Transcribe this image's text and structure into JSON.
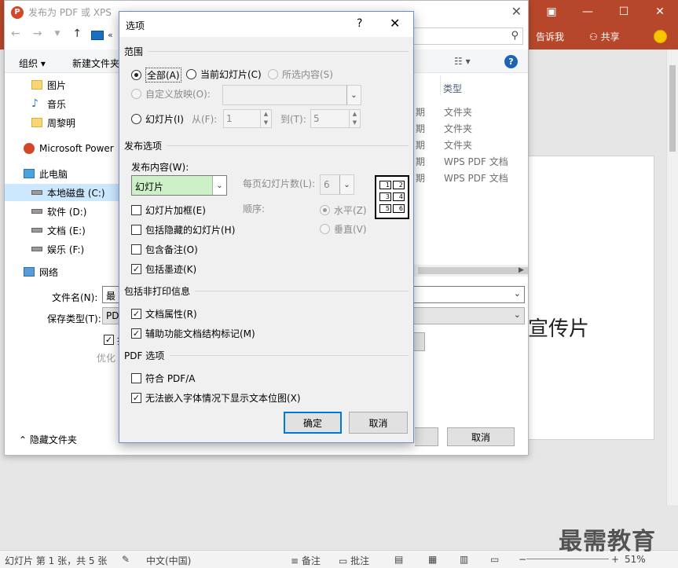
{
  "ppt": {
    "tell_me": "告诉我",
    "share": "共享",
    "slide_title": "宣传片",
    "status": {
      "slide_info": "幻灯片 第 1 张，共 5 张",
      "language": "中文(中国)",
      "notes": "备注",
      "comments": "批注",
      "zoom": "51%"
    },
    "watermark": "最需教育"
  },
  "save_dialog": {
    "title": "发布为 PDF 或 XPS",
    "address_chevron": "«",
    "toolbar": {
      "organize": "组织 ▾",
      "new_folder": "新建文件夹"
    },
    "tree": [
      {
        "label": "图片",
        "icon": "folder-icon"
      },
      {
        "label": "音乐",
        "icon": "music-icon"
      },
      {
        "label": "周黎明",
        "icon": "folder-icon"
      },
      {
        "label": "Microsoft Power",
        "icon": "powerpoint-icon"
      },
      {
        "label": "此电脑",
        "icon": "computer-icon"
      },
      {
        "label": "本地磁盘 (C:)",
        "icon": "drive-icon",
        "selected": true
      },
      {
        "label": "软件 (D:)",
        "icon": "drive-icon"
      },
      {
        "label": "文档 (E:)",
        "icon": "drive-icon"
      },
      {
        "label": "娱乐 (F:)",
        "icon": "drive-icon"
      },
      {
        "label": "网络",
        "icon": "network-icon"
      }
    ],
    "column_type": "类型",
    "files": [
      {
        "date_fragment": "期",
        "type": "文件夹"
      },
      {
        "date_fragment": "期",
        "type": "文件夹"
      },
      {
        "date_fragment": "期",
        "type": "文件夹"
      },
      {
        "date_fragment": "期",
        "type": "WPS PDF 文档"
      },
      {
        "date_fragment": "期",
        "type": "WPS PDF 文档"
      }
    ],
    "filename_label": "文件名(N):",
    "filename_value": "最",
    "savetype_label": "保存类型(T):",
    "savetype_value": "PD",
    "checkbox_fragment": "打",
    "optimize_fragment": "优化",
    "hide_folders": "隐藏文件夹",
    "cancel": "取消"
  },
  "options_dialog": {
    "title": "选项",
    "help": "?",
    "close": "✕",
    "range": {
      "heading": "范围",
      "all": "全部(A)",
      "current_slide": "当前幻灯片(C)",
      "selection": "所选内容(S)",
      "custom_show": "自定义放映(O):",
      "slides": "幻灯片(I)",
      "from_label": "从(F):",
      "from_value": "1",
      "to_label": "到(T):",
      "to_value": "5"
    },
    "publish": {
      "heading": "发布选项",
      "content_label": "发布内容(W):",
      "content_value": "幻灯片",
      "per_page_label": "每页幻灯片数(L):",
      "per_page_value": "6",
      "order_label": "顺序:",
      "horizontal": "水平(Z)",
      "vertical": "垂直(V)",
      "frame": "幻灯片加框(E)",
      "hidden": "包括隐藏的幻灯片(H)",
      "comments": "包含备注(O)",
      "ink": "包括墨迹(K)",
      "layout_numbers": [
        "1",
        "2",
        "3",
        "4",
        "5",
        "6"
      ]
    },
    "nonprint": {
      "heading": "包括非打印信息",
      "doc_props": "文档属性(R)",
      "struct_tags": "辅助功能文档结构标记(M)"
    },
    "pdf": {
      "heading": "PDF 选项",
      "pdfa": "符合 PDF/A",
      "bitmap_text": "无法嵌入字体情况下显示文本位图(X)"
    },
    "ok": "确定",
    "cancel": "取消"
  }
}
